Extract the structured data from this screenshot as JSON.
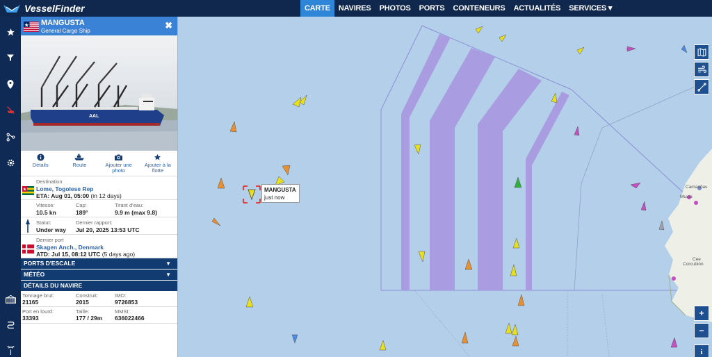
{
  "app": {
    "logo_text": "VesselFinder"
  },
  "nav": [
    "CARTE",
    "NAVIRES",
    "PHOTOS",
    "PORTS",
    "CONTENEURS",
    "ACTUALITÉS",
    "SERVICES ▾"
  ],
  "sidebar_icons": [
    "star-icon",
    "filter-icon",
    "pin-icon",
    "ship-off-icon",
    "route-icon",
    "settings-icon",
    "container-icon",
    "track-icon",
    "antenna-icon"
  ],
  "vessel": {
    "name": "MANGUSTA",
    "type": "General Cargo Ship",
    "close": "✖",
    "actions": [
      {
        "label": "Détails"
      },
      {
        "label": "Route"
      },
      {
        "label": "Ajouter une photo"
      },
      {
        "label": "Ajouter à la flotte"
      }
    ],
    "destination_label": "Destination",
    "destination": "Lome, Togolese Rep",
    "eta": "ETA: Aug 01, 05:00",
    "eta_note": "(in 12 days)",
    "speed_label": "Vitesse:",
    "speed": "10.5 kn",
    "course_label": "Cap:",
    "course": "189°",
    "draught_label": "Tirant d'eau:",
    "draught": "9.9 m (max 9.8)",
    "status_label": "Statut:",
    "status": "Under way",
    "report_label": "Dernier rapport:",
    "report": "Jul 20, 2025 13:53 UTC",
    "last_port_label": "Dernier port",
    "last_port": "Skagen Anch., Denmark",
    "atd": "ATD: Jul 15, 08:12 UTC",
    "atd_note": "(5 days ago)",
    "sections": [
      "PORTS D'ESCALE",
      "MÉTÉO",
      "DÉTAILS DU NAVIRE"
    ],
    "details": {
      "gt_label": "Tonnage brut:",
      "gt": "21165",
      "built_label": "Construit:",
      "built": "2015",
      "imo_label": "IMO:",
      "imo": "9726853",
      "dwt_label": "Port en lourd:",
      "dwt": "33393",
      "size_label": "Taille:",
      "size": "177 / 29m",
      "mmsi_label": "MMSI:",
      "mmsi": "636022466"
    }
  },
  "map": {
    "tooltip_name": "MANGUSTA",
    "tooltip_time": "just now",
    "place_labels": [
      "Camariñas",
      "Muxía",
      "Cee",
      "Corcubión"
    ],
    "zoom_in": "+",
    "zoom_out": "−",
    "info": "i"
  }
}
